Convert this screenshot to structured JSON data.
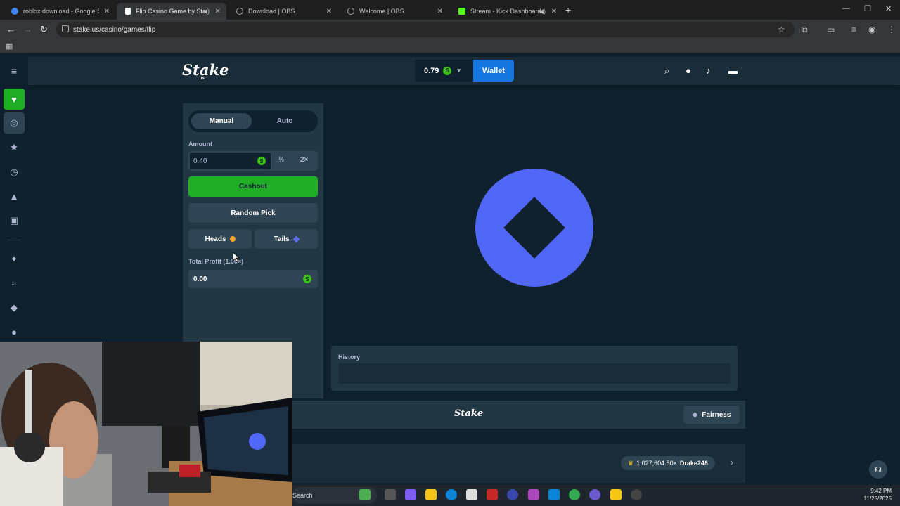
{
  "browser": {
    "tabs": [
      {
        "label": "roblox download - Google Sea",
        "color": "#4285f4",
        "active": false,
        "audio": false
      },
      {
        "label": "Flip Casino Game by Stake.u",
        "color": "#2f4553",
        "active": true,
        "audio": true
      },
      {
        "label": "Download | OBS",
        "color": "#888888",
        "active": false,
        "audio": false
      },
      {
        "label": "Welcome | OBS",
        "color": "#888888",
        "active": false,
        "audio": false
      },
      {
        "label": "Stream - Kick Dashboard",
        "color": "#53fc18",
        "active": false,
        "audio": true
      }
    ],
    "url": "stake.us/casino/games/flip"
  },
  "header": {
    "logo": "Stake",
    "logo_sub": ".us",
    "balance": "0.79",
    "wallet_label": "Wallet"
  },
  "panel": {
    "tabs": [
      "Manual",
      "Auto"
    ],
    "amount_label": "Amount",
    "amount_value": "0.40",
    "half_label": "½",
    "double_label": "2×",
    "cashout_label": "Cashout",
    "random_label": "Random Pick",
    "heads_label": "Heads",
    "tails_label": "Tails",
    "profit_label": "Total Profit (1.00×)",
    "profit_value": "0.00",
    "coin_symbol": "S"
  },
  "game": {
    "history_label": "History"
  },
  "footer": {
    "logo": "Stake",
    "fairness_label": "Fairness",
    "big_win_amount": "1,027,604.50×",
    "big_win_user": "Drake246"
  },
  "taskbar": {
    "search_label": "Search",
    "time": "9:42 PM",
    "date": "11/25/2025"
  },
  "colors": {
    "accent_green": "#1fad25",
    "wallet_blue": "#1475e1",
    "coin_blue": "#5167f5",
    "heads_orange": "#f5a623"
  }
}
